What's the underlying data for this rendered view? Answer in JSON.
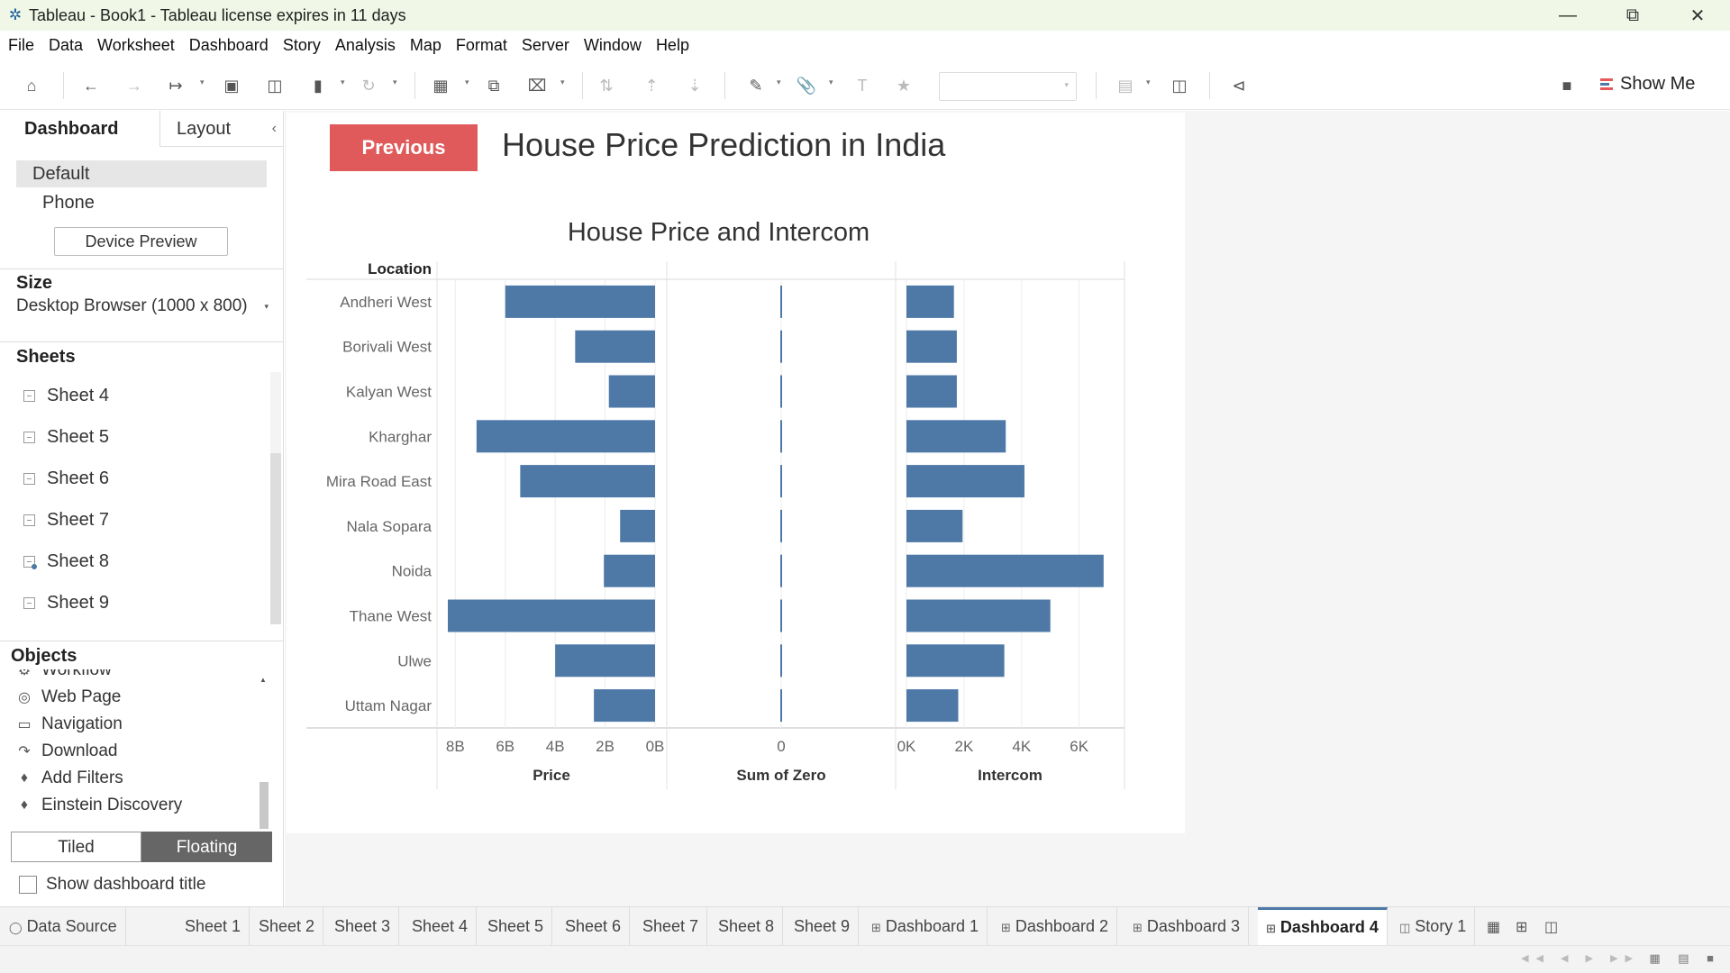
{
  "window": {
    "title": "Tableau - Book1 - Tableau license expires in 11 days",
    "app_icon": "tableau-logo-icon",
    "controls": [
      "minimize",
      "restore",
      "close"
    ]
  },
  "menu": [
    "File",
    "Data",
    "Worksheet",
    "Dashboard",
    "Story",
    "Analysis",
    "Map",
    "Format",
    "Server",
    "Window",
    "Help"
  ],
  "toolbar": {
    "show_me_label": "Show Me"
  },
  "left_panel": {
    "tabs": {
      "dashboard": "Dashboard",
      "layout": "Layout"
    },
    "devices": {
      "default": "Default",
      "phone": "Phone",
      "preview_button": "Device Preview"
    },
    "size": {
      "heading": "Size",
      "value": "Desktop Browser (1000 x 800)"
    },
    "sheets": {
      "heading": "Sheets",
      "items": [
        "Sheet 4",
        "Sheet 5",
        "Sheet 6",
        "Sheet 7",
        "Sheet 8",
        "Sheet 9"
      ]
    },
    "objects": {
      "heading": "Objects",
      "items": [
        "Workflow",
        "Web Page",
        "Navigation",
        "Download",
        "Add Filters",
        "Einstein Discovery"
      ]
    },
    "layout_mode": {
      "tiled": "Tiled",
      "floating": "Floating",
      "selected": "Floating"
    },
    "show_title": {
      "label": "Show dashboard title",
      "checked": false
    }
  },
  "dashboard": {
    "previous_button": "Previous",
    "title": "House Price Prediction in India"
  },
  "chart_data": {
    "type": "bar",
    "title": "House Price and Intercom",
    "row_header": "Location",
    "categories": [
      "Andheri West",
      "Borivali West",
      "Kalyan West",
      "Kharghar",
      "Mira Road East",
      "Nala Sopara",
      "Noida",
      "Thane West",
      "Ulwe",
      "Uttam Nagar"
    ],
    "panes": [
      {
        "measure": "Price",
        "values": [
          6000000000,
          3200000000,
          1850000000,
          7150000000,
          5400000000,
          1400000000,
          2050000000,
          8300000000,
          4000000000,
          2450000000
        ],
        "ticks": [
          "8B",
          "6B",
          "4B",
          "2B",
          "0B"
        ],
        "range": [
          0,
          8300000000
        ],
        "reversed": true,
        "color": "#4e79a7"
      },
      {
        "measure": "Sum of Zero",
        "values": [
          0,
          0,
          0,
          0,
          0,
          0,
          0,
          0,
          0,
          0
        ],
        "ticks": [
          "0"
        ],
        "color": "#4e79a7"
      },
      {
        "measure": "Intercom",
        "values": [
          1650,
          1750,
          1750,
          3450,
          4100,
          1950,
          6850,
          5000,
          3400,
          1800
        ],
        "ticks": [
          "0K",
          "2K",
          "4K",
          "6K"
        ],
        "range": [
          0,
          7200
        ],
        "color": "#4e79a7"
      }
    ]
  },
  "bottom_tabs": {
    "data_source": "Data Source",
    "items": [
      "Sheet 1",
      "Sheet 2",
      "Sheet 3",
      "Sheet 4",
      "Sheet 5",
      "Sheet 6",
      "Sheet 7",
      "Sheet 8",
      "Sheet 9",
      "Dashboard 1",
      "Dashboard 2",
      "Dashboard 3",
      "Dashboard 4",
      "Story 1"
    ],
    "active": "Dashboard 4"
  }
}
